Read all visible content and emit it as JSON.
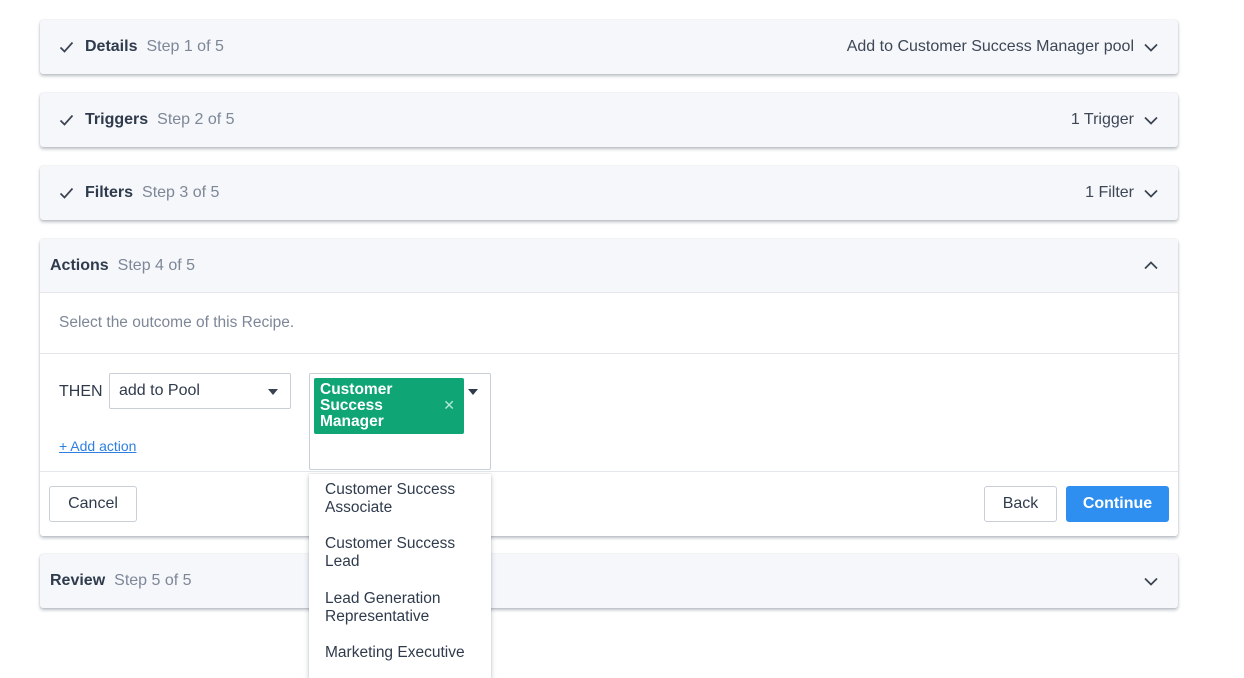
{
  "steps": {
    "details": {
      "title": "Details",
      "step": "Step 1 of 5",
      "summary": "Add to Customer Success Manager pool"
    },
    "triggers": {
      "title": "Triggers",
      "step": "Step 2 of 5",
      "summary": "1 Trigger"
    },
    "filters": {
      "title": "Filters",
      "step": "Step 3 of 5",
      "summary": "1 Filter"
    },
    "actions": {
      "title": "Actions",
      "step": "Step 4 of 5"
    },
    "review": {
      "title": "Review",
      "step": "Step 5 of 5"
    }
  },
  "actions_panel": {
    "description": "Select the outcome of this Recipe.",
    "then_label": "THEN",
    "action_select": {
      "value": "add to Pool"
    },
    "pool_select": {
      "selected_tag": "Customer Success Manager",
      "options": [
        "Customer Success Associate",
        "Customer Success Lead",
        "Lead Generation Representative",
        "Marketing Executive"
      ]
    },
    "add_action_link": "+ Add action",
    "buttons": {
      "cancel": "Cancel",
      "back": "Back",
      "continue": "Continue"
    }
  },
  "colors": {
    "accent": "#2f8ff0",
    "tag": "#0fa574",
    "link": "#2e7fe0"
  },
  "icons": {
    "completed_step": "check-icon",
    "collapsed": "chevron-down-icon",
    "expanded": "chevron-up-icon",
    "remove_tag": "close-icon",
    "dropdown": "caret-down-icon"
  }
}
